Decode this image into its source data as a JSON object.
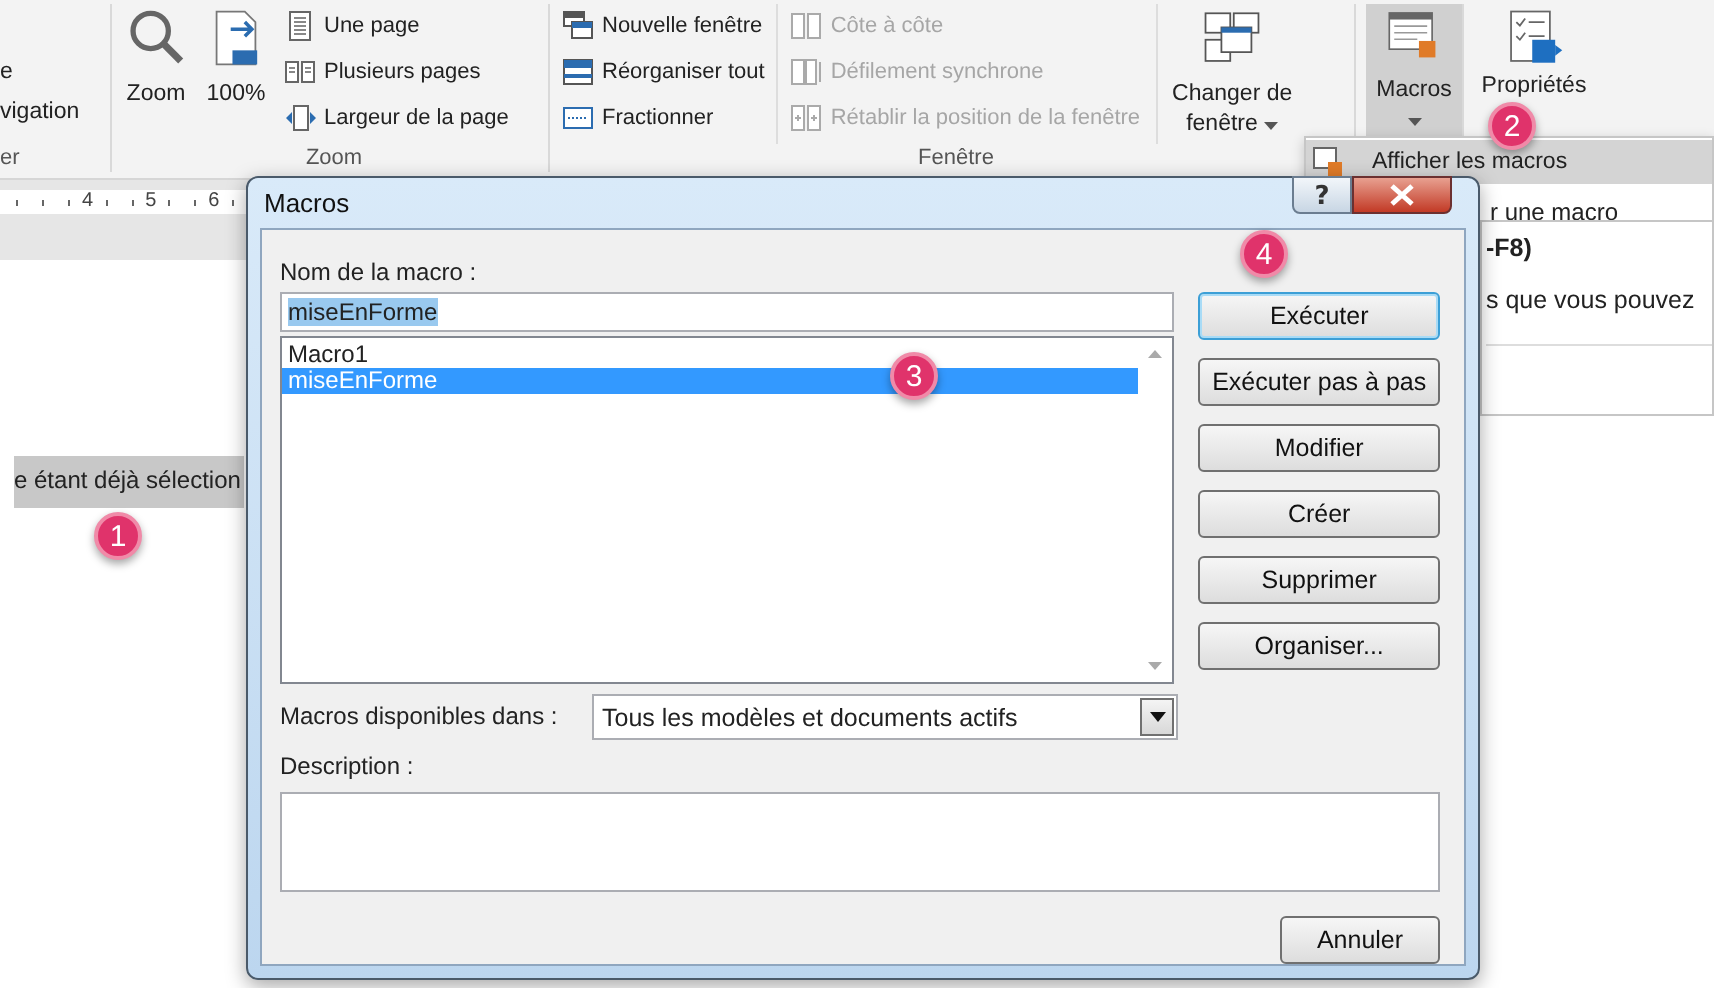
{
  "ribbon": {
    "show_group": {
      "items": [
        "e",
        "vigation"
      ],
      "label": "er"
    },
    "zoom_group": {
      "label": "Zoom",
      "large_buttons": [
        {
          "label": "Zoom"
        },
        {
          "label": "100%"
        }
      ],
      "small_buttons": [
        {
          "label": "Une page"
        },
        {
          "label": "Plusieurs pages"
        },
        {
          "label": "Largeur de la page"
        }
      ]
    },
    "window_group": {
      "label": "Fenêtre",
      "small_buttons": [
        {
          "label": "Nouvelle fenêtre",
          "disabled": false
        },
        {
          "label": "Réorganiser tout",
          "disabled": false
        },
        {
          "label": "Fractionner",
          "disabled": false
        }
      ],
      "sync_buttons": [
        {
          "label": "Côte à côte",
          "disabled": true
        },
        {
          "label": "Défilement synchrone",
          "disabled": true
        },
        {
          "label": "Rétablir la position de la fenêtre",
          "disabled": true
        }
      ],
      "switch_button": {
        "lines": [
          "Changer de",
          "fenêtre"
        ],
        "dropdown": true
      }
    },
    "macros_button": {
      "label": "Macros",
      "selected": true,
      "dropdown": true
    },
    "properties_button": {
      "label": "Propriétés"
    }
  },
  "document": {
    "ruler": [
      "4",
      "5",
      "6"
    ],
    "text": "e étant déjà sélection",
    "text_selected": true
  },
  "menu": {
    "items": [
      {
        "label": "Afficher les macros",
        "selected": true
      },
      {
        "label": "r une macro",
        "selected": false
      }
    ],
    "tooltip": [
      "-F8)",
      "s que vous pouvez"
    ]
  },
  "dialog": {
    "title": "Macros",
    "help_button": "?",
    "name_label": "Nom de la macro :",
    "name_value": "miseEnForme",
    "name_value_selected": true,
    "macros": [
      {
        "label": "Macro1",
        "selected": false
      },
      {
        "label": "miseEnForme",
        "selected": true
      }
    ],
    "buttons": [
      {
        "label": "Exécuter",
        "default": true
      },
      {
        "label": "Exécuter pas à pas",
        "default": false
      },
      {
        "label": "Modifier",
        "default": false
      },
      {
        "label": "Créer",
        "default": false
      },
      {
        "label": "Supprimer",
        "default": false
      },
      {
        "label": "Organiser...",
        "default": false
      }
    ],
    "available_label": "Macros disponibles dans :",
    "available_value": "Tous les modèles et documents actifs",
    "description_label": "Description :",
    "cancel_button": "Annuler"
  },
  "callouts": [
    "1",
    "2",
    "3",
    "4"
  ]
}
